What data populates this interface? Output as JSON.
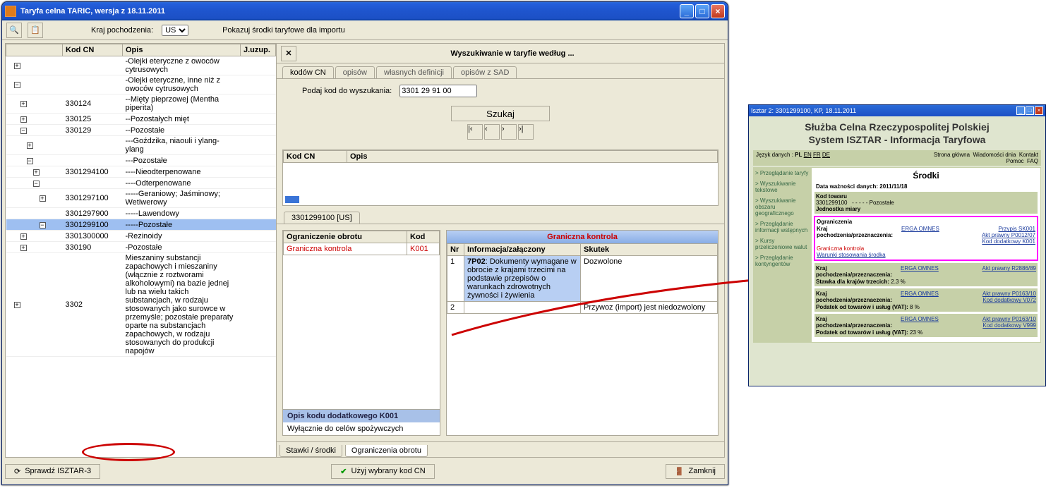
{
  "window": {
    "title": "Taryfa celna TARIC, wersja z 18.11.2011"
  },
  "toolbar": {
    "originLabel": "Kraj pochodzenia:",
    "originValue": "US",
    "showMeansLabel": "Pokazuj środki taryfowe dla importu"
  },
  "leftHeaders": {
    "tree": "",
    "cn": "Kod CN",
    "desc": "Opis",
    "ju": "J.uzup."
  },
  "leftRows": [
    {
      "depth": 1,
      "box": "+",
      "cn": "",
      "desc": "-Olejki eteryczne z owoców cytrusowych",
      "sel": false
    },
    {
      "depth": 1,
      "box": "-",
      "cn": "",
      "desc": "-Olejki eteryczne, inne niż z owoców cytrusowych",
      "sel": false
    },
    {
      "depth": 2,
      "box": "+",
      "cn": "330124",
      "desc": "--Mięty pieprzowej (Mentha piperita)",
      "sel": false
    },
    {
      "depth": 2,
      "box": "+",
      "cn": "330125",
      "desc": "--Pozostałych mięt",
      "sel": false
    },
    {
      "depth": 2,
      "box": "-",
      "cn": "330129",
      "desc": "--Pozostałe",
      "sel": false
    },
    {
      "depth": 3,
      "box": "+",
      "cn": "",
      "desc": "---Goździka, niaouli i ylang-ylang",
      "sel": false
    },
    {
      "depth": 3,
      "box": "-",
      "cn": "",
      "desc": "---Pozostałe",
      "sel": false
    },
    {
      "depth": 4,
      "box": "+",
      "cn": "3301294100",
      "desc": "----Nieodterpenowane",
      "sel": false
    },
    {
      "depth": 4,
      "box": "-",
      "cn": "",
      "desc": "----Odterpenowane",
      "sel": false
    },
    {
      "depth": 5,
      "box": "+",
      "cn": "3301297100",
      "desc": "-----Geraniowy; Jaśminowy; Wetiwerowy",
      "sel": false
    },
    {
      "depth": 5,
      "box": "",
      "cn": "3301297900",
      "desc": "-----Lawendowy",
      "sel": false
    },
    {
      "depth": 5,
      "box": "-",
      "cn": "3301299100",
      "desc": "-----Pozostałe",
      "sel": true
    },
    {
      "depth": 2,
      "box": "+",
      "cn": "3301300000",
      "desc": "-Rezinoidy",
      "sel": false
    },
    {
      "depth": 2,
      "box": "+",
      "cn": "330190",
      "desc": "-Pozostałe",
      "sel": false
    },
    {
      "depth": 1,
      "box": "+",
      "cn": "3302",
      "desc": "Mieszaniny substancji zapachowych i mieszaniny (włącznie z roztworami alkoholowymi) na bazie jednej lub na wielu takich substancjach, w rodzaju stosowanych jako surowce w przemyśle; pozostałe preparaty oparte na substancjach zapachowych, w rodzaju stosowanych do produkcji napojów",
      "sel": false
    }
  ],
  "search": {
    "title": "Wyszukiwanie w taryfie według ...",
    "tabs": [
      "kodów CN",
      "opisów",
      "własnych definicji",
      "opisów z SAD"
    ],
    "codeLabel": "Podaj kod do wyszukania:",
    "codeValue": "3301 29 91 00",
    "searchBtn": "Szukaj",
    "resultHeaders": {
      "cn": "Kod CN",
      "desc": "Opis"
    }
  },
  "tariffTab": "3301299100 [US]",
  "restrictionBox": {
    "headers": {
      "name": "Ograniczenie obrotu",
      "code": "Kod"
    },
    "rows": [
      {
        "name": "Graniczna kontrola",
        "code": "K001"
      }
    ],
    "bottomTitle": "Opis kodu dodatkowego K001",
    "bottomText": "Wyłącznie do celów spożywczych"
  },
  "controlBox": {
    "title": "Graniczna kontrola",
    "headers": {
      "nr": "Nr",
      "info": "Informacja/załączony",
      "effect": "Skutek"
    },
    "rows": [
      {
        "nr": "1",
        "code": "7P02",
        "info": ": Dokumenty wymagane w obrocie z krajami trzecimi na podstawie przepisów o warunkach zdrowotnych żywności i żywienia",
        "effect": "Dozwolone",
        "blue": true
      },
      {
        "nr": "2",
        "code": "",
        "info": "",
        "effect": "Przywoz (import) jest niedozwolony",
        "blue": false
      }
    ]
  },
  "bottomTabs": {
    "inactive": "Stawki / środki",
    "active": "Ograniczenia obrotu"
  },
  "footer": {
    "isztar": "Sprawdź ISZTAR-3",
    "use": "Użyj wybrany kod CN",
    "close": "Zamknij"
  },
  "isztar": {
    "winTitle": "Isztar 2: 3301299100, KP, 18.11.2011",
    "head1": "Służba Celna Rzeczypospolitej Polskiej",
    "head2": "System ISZTAR - Informacja Taryfowa",
    "langLabel": "Język danych :",
    "langs": [
      "PL",
      "EN",
      "FR",
      "DE"
    ],
    "topRight": [
      "Strona główna",
      "Wiadomości dnia",
      "Kontakt",
      "Pomoc",
      "FAQ"
    ],
    "side": [
      "> Przeglądanie taryfy",
      "> Wyszukiwanie tekstowe",
      "> Wyszukiwanie obszaru geograficznego",
      "> Przeglądanie informacji wstępnych",
      "> Kursy przeliczeniowe walut",
      "> Przeglądanie kontyngentów"
    ],
    "contentTitle": "Środki",
    "dataWaz": "Data ważności danych: 2011/11/18",
    "kodTowaruLbl": "Kod towaru",
    "kodTowaruVal": "3301299100",
    "kodTowaruDesc": "- - - - - Pozostałe",
    "jednostka": "Jednostka miary",
    "ograniczenia": "Ograniczenia",
    "origin": "Kraj pochodzenia/przeznaczenia:",
    "erga": "ERGA OMNES",
    "gran": "Graniczna kontrola",
    "warunki": "Warunki stosowania środka",
    "lines": [
      {
        "r": [
          "Przypis SK001",
          "Akt prawny P0012/07",
          "Kod dodatkowy K001"
        ]
      },
      {
        "lbl": "Stawka dla krajów trzecich:",
        "val": "2.3  %",
        "r": "Akt prawny R2886/89"
      },
      {
        "lbl": "Podatek od towarów i usług (VAT):",
        "val": "8  %",
        "r": "Akt prawny P0163/10",
        "r2": "Kod dodatkowy V072"
      },
      {
        "lbl": "Podatek od towarów i usług (VAT):",
        "val": "23  %",
        "r": "Akt prawny P0163/10",
        "r2": "Kod dodatkowy V999"
      }
    ]
  }
}
